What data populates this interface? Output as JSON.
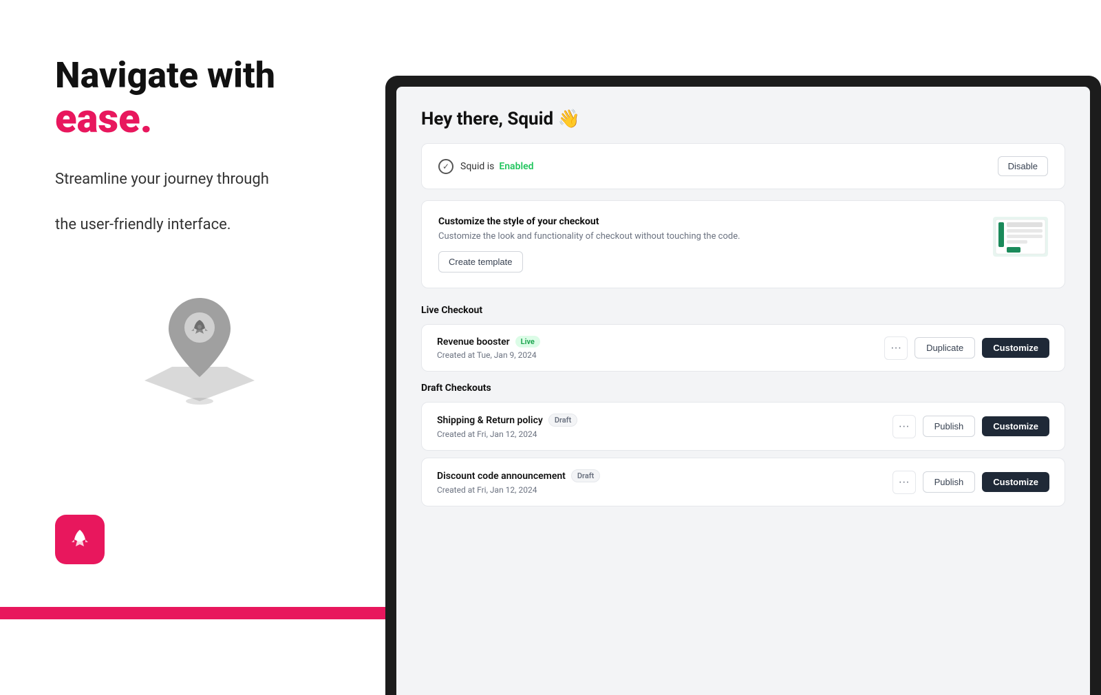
{
  "left": {
    "headline_line1": "Navigate with",
    "headline_pink": "ease.",
    "subtext_line1": "Streamline your journey through",
    "subtext_line2": "the user-friendly interface.",
    "pink_accent": "#e8175d"
  },
  "screen": {
    "greeting": "Hey there, Squid 👋",
    "status_text": "Squid is",
    "status_value": "Enabled",
    "disable_button": "Disable",
    "customize_section": {
      "title": "Customize the style of your checkout",
      "description": "Customize the look and functionality of checkout without touching the code.",
      "create_template_button": "Create template"
    },
    "live_checkout_label": "Live Checkout",
    "live_items": [
      {
        "name": "Revenue booster",
        "badge": "Live",
        "created": "Created at Tue, Jan 9, 2024",
        "buttons": [
          "...",
          "Duplicate",
          "Customize"
        ]
      }
    ],
    "draft_checkouts_label": "Draft Checkouts",
    "draft_items": [
      {
        "name": "Shipping & Return policy",
        "badge": "Draft",
        "created": "Created at Fri, Jan 12, 2024",
        "buttons": [
          "...",
          "Publish",
          "Customize"
        ]
      },
      {
        "name": "Discount code announcement",
        "badge": "Draft",
        "created": "Created at Fri, Jan 12, 2024",
        "buttons": [
          "...",
          "Publish",
          "Customize"
        ]
      }
    ]
  }
}
